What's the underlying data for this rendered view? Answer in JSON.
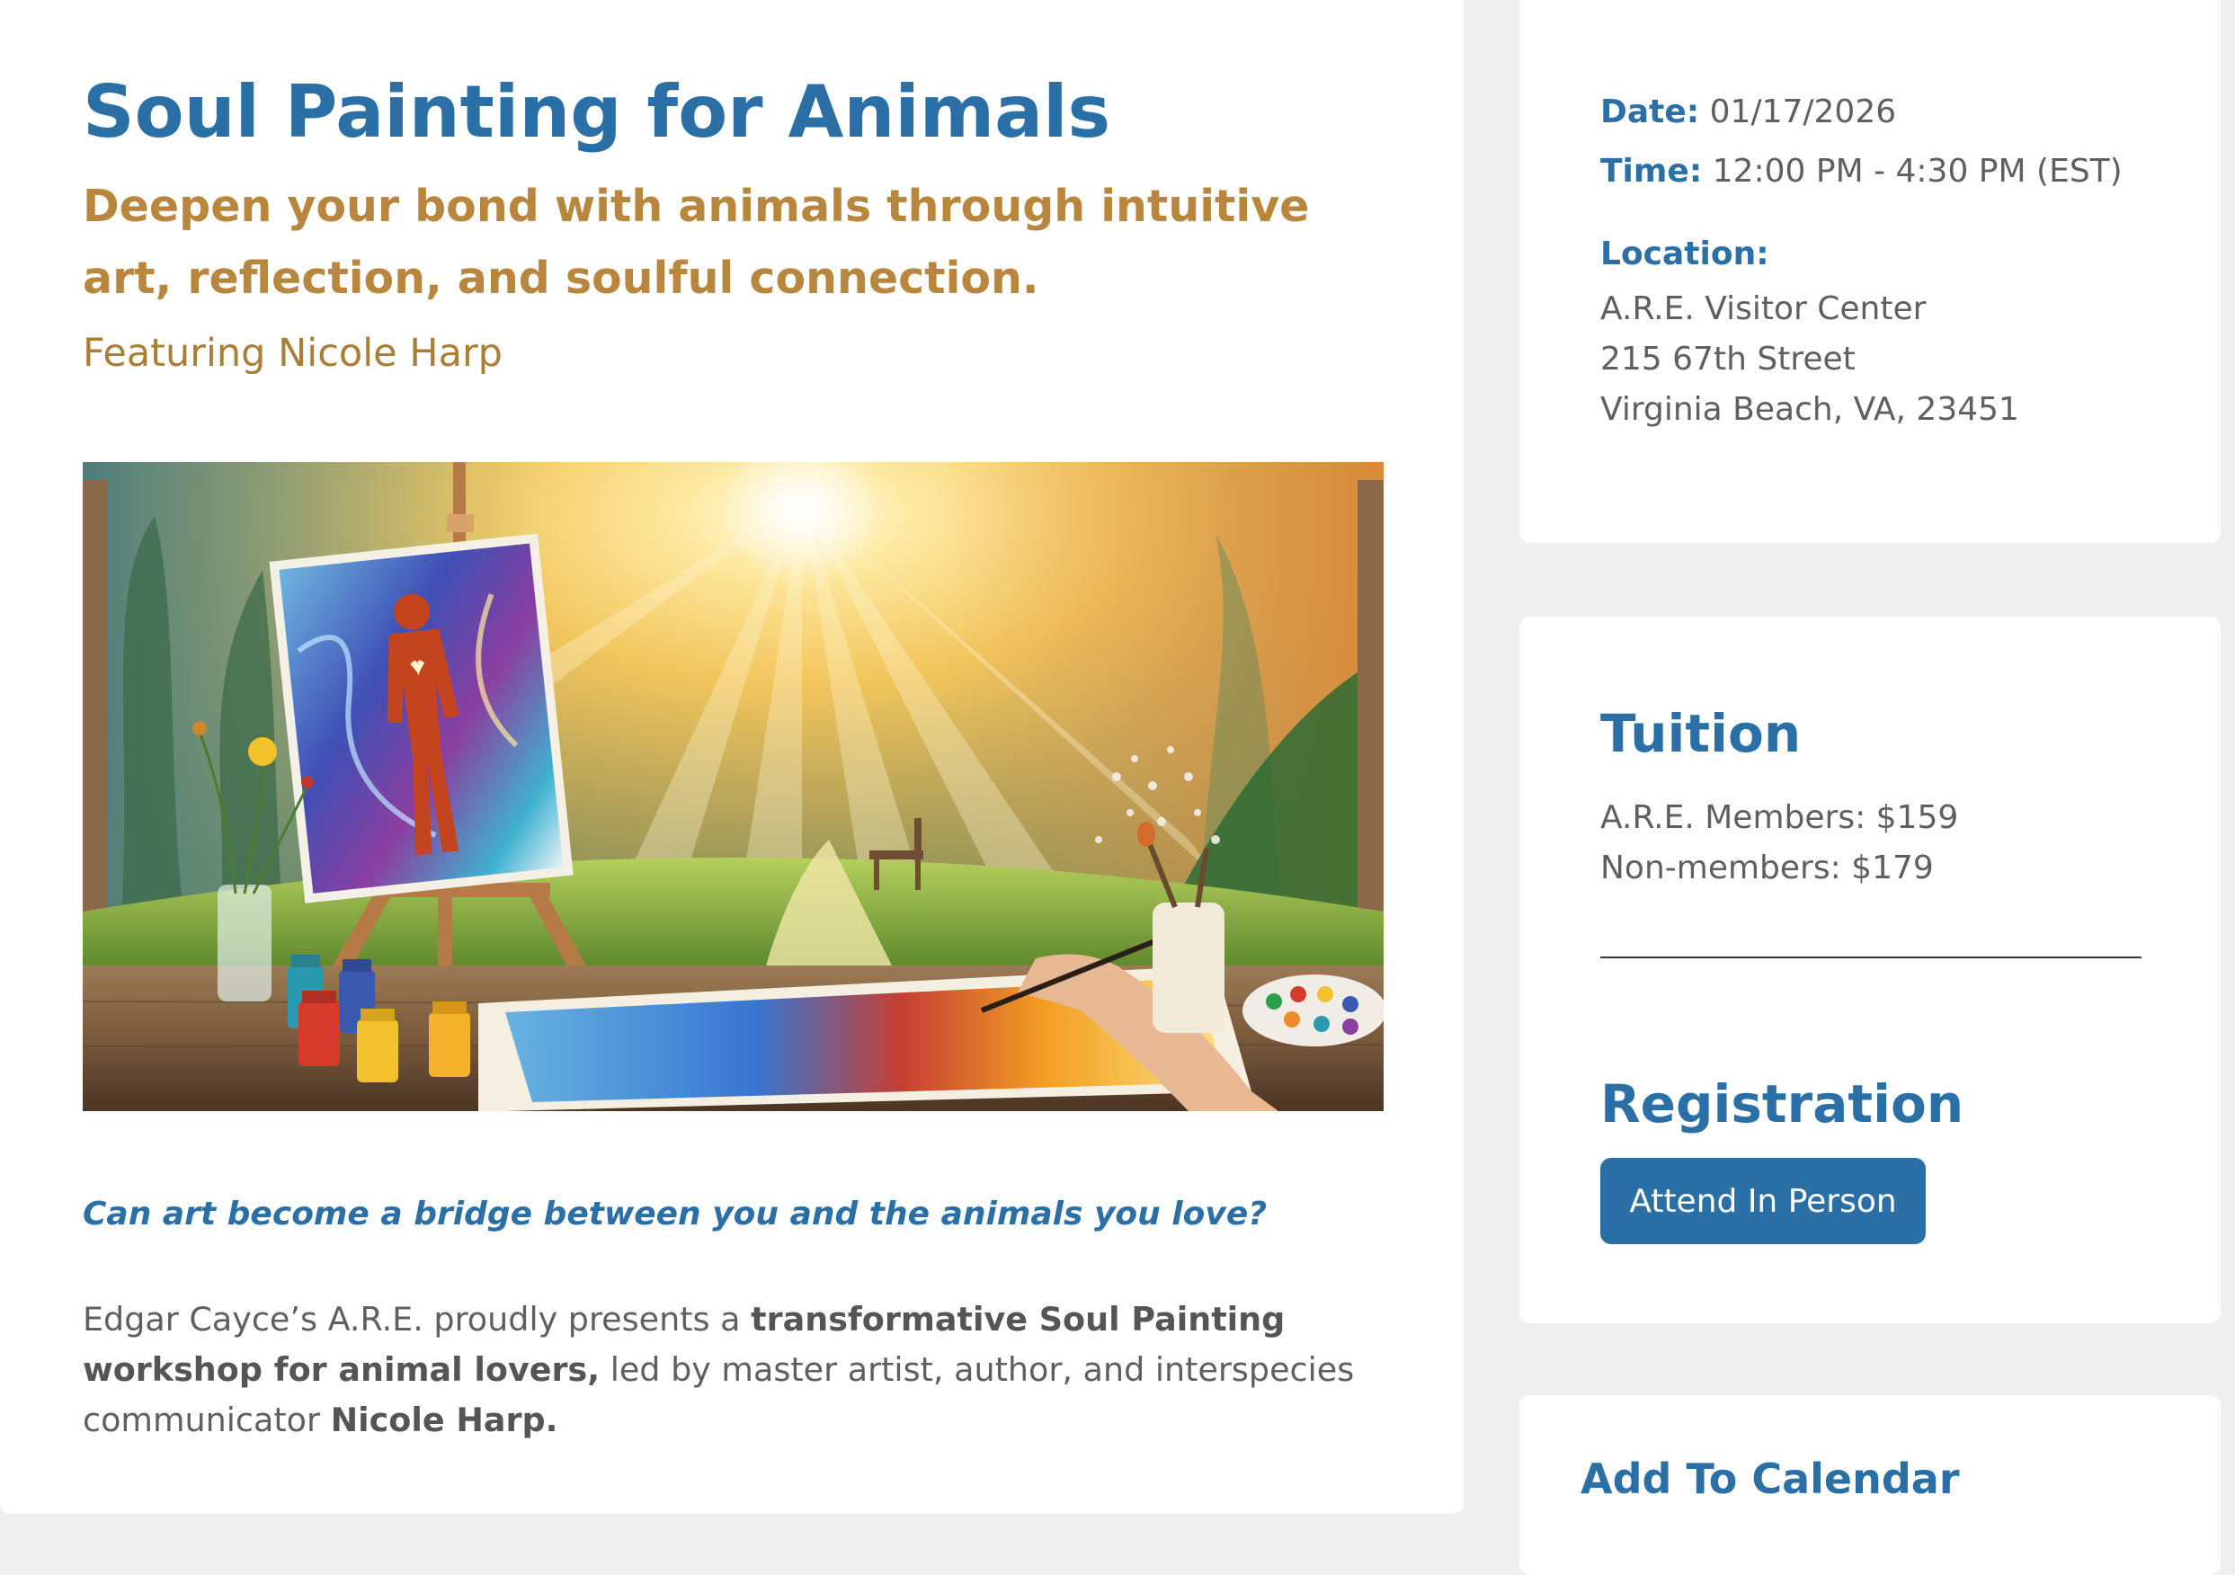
{
  "event": {
    "title": "Soul Painting for Animals",
    "subtitle": "Deepen your bond with animals through intuitive art, reflection, and soulful connection.",
    "featuring": "Featuring Nicole Harp",
    "hero_image": "soul-painting-artwork",
    "question": "Can art become a bridge between you and the animals you love?",
    "intro": {
      "part1": "Edgar Cayce’s A.R.E. proudly presents a ",
      "bold1": "transformative Soul Painting workshop for animal lovers,",
      "part2": " led by master artist, author, and interspecies communicator ",
      "bold2": "Nicole Harp."
    }
  },
  "details": {
    "date_label": "Date:",
    "date_value": "01/17/2026",
    "time_label": "Time:",
    "time_value": "12:00 PM - 4:30 PM (EST)",
    "location_label": "Location:",
    "address": [
      "A.R.E. Visitor Center",
      "215 67th Street",
      "Virginia Beach, VA, 23451"
    ]
  },
  "tuition": {
    "heading": "Tuition",
    "members": "A.R.E. Members: $159",
    "non_members": "Non-members: $179"
  },
  "registration": {
    "heading": "Registration",
    "button_label": "Attend In Person"
  },
  "calendar": {
    "heading": "Add To Calendar"
  },
  "colors": {
    "primary": "#2a6fa5",
    "gold": "#b8863c",
    "text": "#5f5f5f",
    "background": "#f0eff0"
  }
}
